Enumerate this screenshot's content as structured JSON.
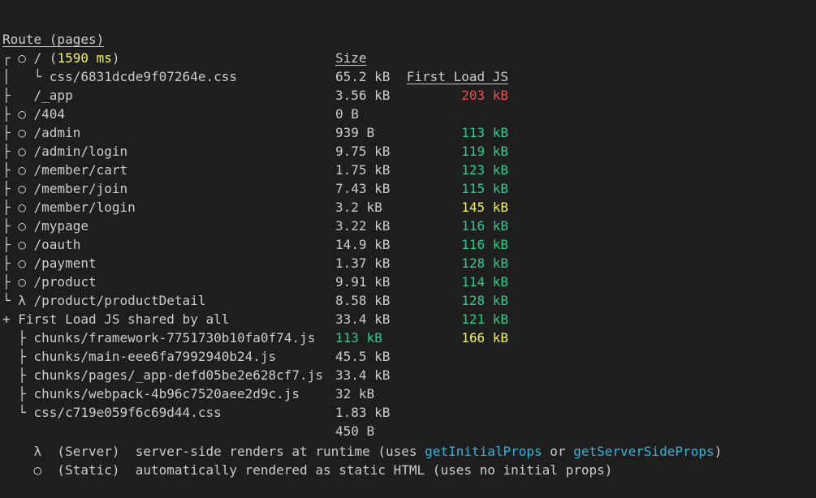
{
  "colors": {
    "background": "#1e1e1e",
    "text": "#cccccc",
    "green": "#23d18b",
    "yellow": "#f5f543",
    "red": "#f14c4c",
    "blue": "#29b8db"
  },
  "header": {
    "route": "Route (pages)",
    "size": "Size",
    "first_load": "First Load JS"
  },
  "routes": [
    {
      "prefix": "┌ ○ / (",
      "time": "1590 ms",
      "suffix": ")",
      "size": "65.2 kB",
      "load": "203 kB",
      "load_color": "red"
    },
    {
      "prefix": "│   └ css/6831dcde9f07264e.css",
      "size": "3.56 kB",
      "load": "",
      "load_color": ""
    },
    {
      "prefix": "├   /_app",
      "size": "0 B",
      "load": "113 kB",
      "load_color": "green"
    },
    {
      "prefix": "├ ○ /404",
      "size": "939 B",
      "load": "119 kB",
      "load_color": "green"
    },
    {
      "prefix": "├ ○ /admin",
      "size": "9.75 kB",
      "load": "123 kB",
      "load_color": "green"
    },
    {
      "prefix": "├ ○ /admin/login",
      "size": "1.75 kB",
      "load": "115 kB",
      "load_color": "green"
    },
    {
      "prefix": "├ ○ /member/cart",
      "size": "7.43 kB",
      "load": "145 kB",
      "load_color": "yellow"
    },
    {
      "prefix": "├ ○ /member/join",
      "size": "3.2 kB",
      "load": "116 kB",
      "load_color": "green"
    },
    {
      "prefix": "├ ○ /member/login",
      "size": "3.22 kB",
      "load": "116 kB",
      "load_color": "green"
    },
    {
      "prefix": "├ ○ /mypage",
      "size": "14.9 kB",
      "load": "128 kB",
      "load_color": "green"
    },
    {
      "prefix": "├ ○ /oauth",
      "size": "1.37 kB",
      "load": "114 kB",
      "load_color": "green"
    },
    {
      "prefix": "├ ○ /payment",
      "size": "9.91 kB",
      "load": "128 kB",
      "load_color": "green"
    },
    {
      "prefix": "├ ○ /product",
      "size": "8.58 kB",
      "load": "121 kB",
      "load_color": "green"
    },
    {
      "prefix": "└ λ /product/productDetail",
      "size": "33.4 kB",
      "load": "166 kB",
      "load_color": "yellow"
    }
  ],
  "shared": {
    "label": "+ First Load JS shared by all",
    "size": "113 kB",
    "chunks": [
      {
        "name": "  ├ chunks/framework-7751730b10fa0f74.js",
        "size": "45.5 kB"
      },
      {
        "name": "  ├ chunks/main-eee6fa7992940b24.js",
        "size": "33.4 kB"
      },
      {
        "name": "  ├ chunks/pages/_app-defd05be2e628cf7.js",
        "size": "32 kB"
      },
      {
        "name": "  ├ chunks/webpack-4b96c7520aee2d9c.js",
        "size": "1.83 kB"
      },
      {
        "name": "  └ css/c719e059f6c69d44.css",
        "size": "450 B"
      }
    ]
  },
  "legend": {
    "server": {
      "text": "λ  (Server)  server-side renders at runtime (uses ",
      "fn1": "getInitialProps",
      "mid": " or ",
      "fn2": "getServerSideProps",
      "end": ")"
    },
    "static": {
      "text": "○  (Static)  automatically rendered as static HTML (uses no initial props)"
    }
  }
}
